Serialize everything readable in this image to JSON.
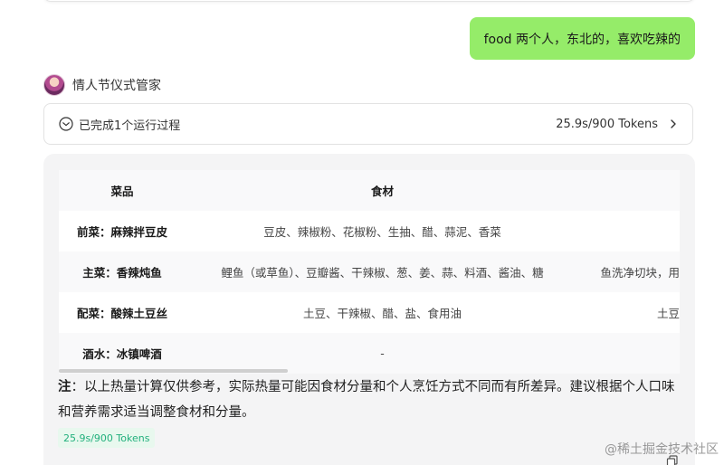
{
  "user_message": "food 两个人，东北的，喜欢吃辣的",
  "bot": {
    "name": "情人节仪式管家",
    "icon": "avatar"
  },
  "process": {
    "status": "已完成1个运行过程",
    "metrics": "25.9s/900 Tokens",
    "icon": "check-circle-icon"
  },
  "table": {
    "headers": {
      "dish": "菜品",
      "ingredients": "食材"
    },
    "rows": [
      {
        "dish": "前菜：麻辣拌豆皮",
        "ingredients": "豆皮、辣椒粉、花椒粉、生抽、醋、蒜泥、香菜",
        "extra": ""
      },
      {
        "dish": "主菜：香辣炖鱼",
        "ingredients": "鲤鱼（或草鱼）、豆瓣酱、干辣椒、葱、姜、蒜、料酒、酱油、糖",
        "extra": "鱼洗净切块，用"
      },
      {
        "dish": "配菜：酸辣土豆丝",
        "ingredients": "土豆、干辣椒、醋、盐、食用油",
        "extra": "土豆"
      },
      {
        "dish": "酒水：冰镇啤酒",
        "ingredients": "-",
        "extra": ""
      }
    ]
  },
  "note": {
    "label": "注",
    "text": "：以上热量计算仅供参考，实际热量可能因食材分量和个人烹饪方式不同而有所差异。建议根据个人口味和营养需求适当调整食材和分量。"
  },
  "token_badge": "25.9s/900 Tokens",
  "watermark": "@稀土掘金技术社区",
  "colors": {
    "user_bubble": "#95ec69",
    "token_badge_text": "#22b07d",
    "token_badge_bg": "#e8f8ee",
    "card_bg": "#f4f4f5"
  }
}
